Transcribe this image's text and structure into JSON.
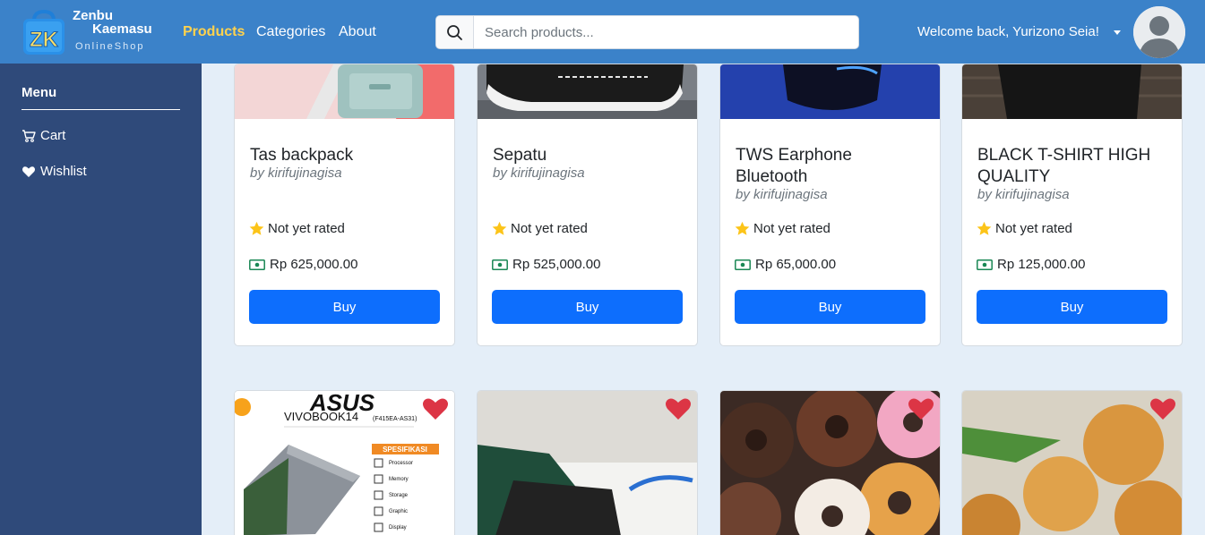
{
  "navbar": {
    "logo_text": "ZK",
    "brand_line1": "Zenbu",
    "brand_line2": "Kaemasu",
    "brand_tagline": "OnlineShop",
    "links": [
      {
        "label": "Products",
        "active": true
      },
      {
        "label": "Categories",
        "active": false
      },
      {
        "label": "About",
        "active": false
      }
    ],
    "search_placeholder": "Search products...",
    "welcome": "Welcome back, Yurizono Seia!",
    "bg_color": "#3b82c9",
    "active_color": "#ffd24d"
  },
  "sidebar": {
    "title": "Menu",
    "items": [
      {
        "label": "Cart",
        "icon": "cart-icon"
      },
      {
        "label": "Wishlist",
        "icon": "heart-icon"
      }
    ],
    "bg_color": "#2f4a7a"
  },
  "products": [
    {
      "title": "Tas backpack",
      "seller": "by kirifujinagisa",
      "rating": "Not yet rated",
      "price": "Rp 625,000.00",
      "buy": "Buy"
    },
    {
      "title": "Sepatu",
      "seller": "by kirifujinagisa",
      "rating": "Not yet rated",
      "price": "Rp 525,000.00",
      "buy": "Buy"
    },
    {
      "title": "TWS Earphone Bluetooth",
      "seller": "by kirifujinagisa",
      "rating": "Not yet rated",
      "price": "Rp 65,000.00",
      "buy": "Buy"
    },
    {
      "title": "BLACK T-SHIRT HIGH QUALITY",
      "seller": "by kirifujinagisa",
      "rating": "Not yet rated",
      "price": "Rp 125,000.00",
      "buy": "Buy"
    }
  ],
  "laptop_ad": {
    "brand": "ASUS",
    "model": "VIVOBOOK14",
    "model_code": "(F415EA-AS31)",
    "spec_title": "SPESIFIKASI",
    "specs": [
      "Processor",
      "Memory",
      "Storage",
      "Graphic",
      "Display"
    ]
  },
  "accent_color": "#0d6efd"
}
